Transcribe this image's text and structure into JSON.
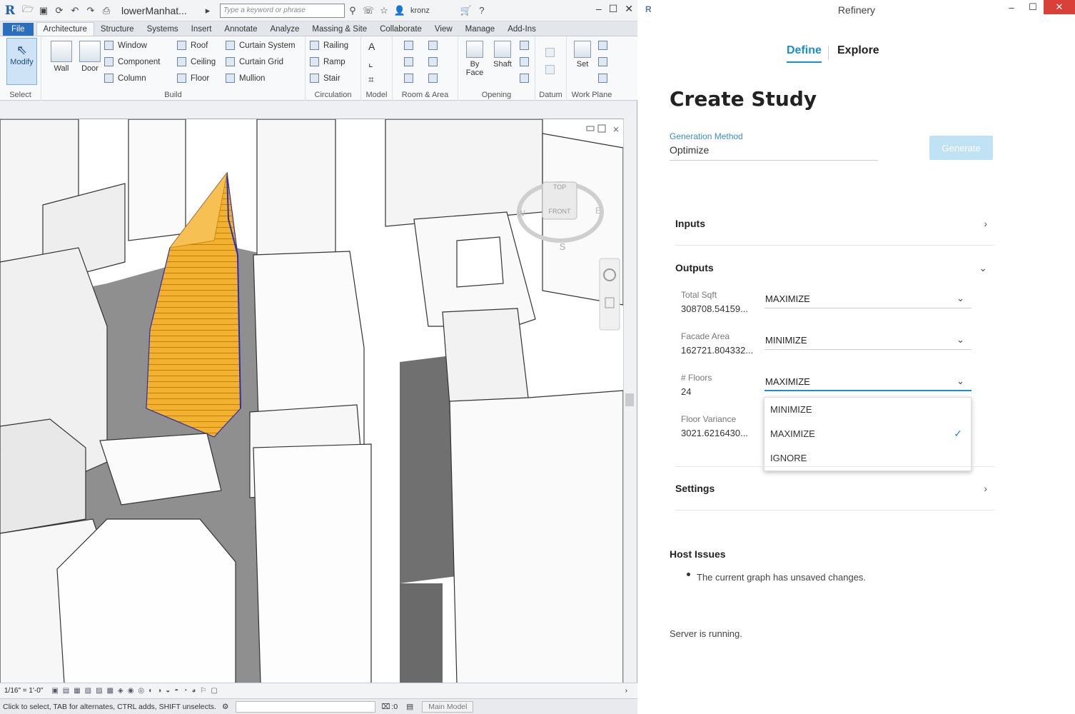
{
  "revit": {
    "doc_title": "lowerManhat...",
    "search_placeholder": "Type a keyword or phrase",
    "user": "kronz",
    "tabs": [
      "File",
      "Architecture",
      "Structure",
      "Systems",
      "Insert",
      "Annotate",
      "Analyze",
      "Massing & Site",
      "Collaborate",
      "View",
      "Manage",
      "Add-Ins"
    ],
    "ribbon": {
      "modify": "Modify",
      "select": "Select",
      "wall": "Wall",
      "door": "Door",
      "window": "Window",
      "component": "Component",
      "column": "Column",
      "roof": "Roof",
      "ceiling": "Ceiling",
      "floor": "Floor",
      "curtain_system": "Curtain System",
      "curtain_grid": "Curtain Grid",
      "mullion": "Mullion",
      "build": "Build",
      "railing": "Railing",
      "ramp": "Ramp",
      "stair": "Stair",
      "circulation": "Circulation",
      "model": "Model",
      "room_area": "Room & Area",
      "by_face": "By Face",
      "shaft": "Shaft",
      "opening": "Opening",
      "datum": "Datum",
      "set": "Set",
      "work_plane": "Work Plane"
    },
    "viewcube": {
      "top": "TOP",
      "front": "FRONT",
      "s": "S",
      "e": "E",
      "w": "W"
    },
    "scale": "1/16\" = 1'-0\"",
    "status": "Click to select, TAB for alternates, CTRL adds, SHIFT unselects.",
    "model_dropdown": "Main Model",
    "zero": ":0"
  },
  "refinery": {
    "window_title": "Refinery",
    "nav": {
      "define": "Define",
      "explore": "Explore"
    },
    "page_title": "Create Study",
    "generation_method_label": "Generation Method",
    "generation_method_value": "Optimize",
    "generate_button": "Generate",
    "sections": {
      "inputs": "Inputs",
      "outputs": "Outputs",
      "settings": "Settings"
    },
    "outputs": [
      {
        "label": "Total Sqft",
        "value": "308708.54159...",
        "goal": "MAXIMIZE"
      },
      {
        "label": "Facade Area",
        "value": "162721.804332...",
        "goal": "MINIMIZE"
      },
      {
        "label": "# Floors",
        "value": "24",
        "goal": "MAXIMIZE"
      },
      {
        "label": "Floor Variance",
        "value": "3021.6216430..."
      }
    ],
    "dropdown_options": [
      "MINIMIZE",
      "MAXIMIZE",
      "IGNORE"
    ],
    "dropdown_selected": "MAXIMIZE",
    "host_issues_label": "Host Issues",
    "host_issues": [
      "The current graph has unsaved changes."
    ],
    "server_status": "Server is running."
  },
  "colors": {
    "accent": "#1a8ed6",
    "revit_blue": "#2a6ebd",
    "tower": "#f2b230"
  }
}
